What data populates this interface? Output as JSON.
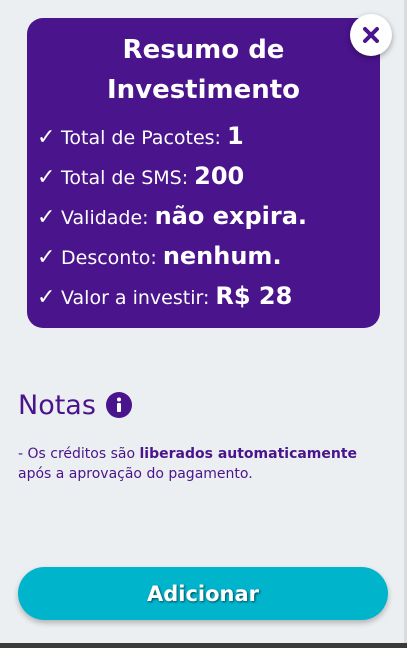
{
  "summary": {
    "title_line1": "Resumo de",
    "title_line2": "Investimento",
    "check_symbol": "✓",
    "rows": [
      {
        "label": "Total de Pacotes:",
        "value": "1"
      },
      {
        "label": "Total de SMS:",
        "value": "200"
      },
      {
        "label": "Validade:",
        "value": "não expira."
      },
      {
        "label": "Desconto:",
        "value": "nenhum."
      },
      {
        "label": "Valor a investir:",
        "value": "R$ 28"
      }
    ]
  },
  "close_icon": "close-icon",
  "notes": {
    "title": "Notas",
    "info_icon": "info-icon",
    "text_prefix": "- Os créditos são ",
    "text_bold": "liberados automaticamente",
    "text_suffix": " após a aprovação do pagamento."
  },
  "add_button": {
    "label": "Adicionar"
  },
  "colors": {
    "primary": "#4a148c",
    "accent": "#00b4cc",
    "background": "#eceff1"
  }
}
